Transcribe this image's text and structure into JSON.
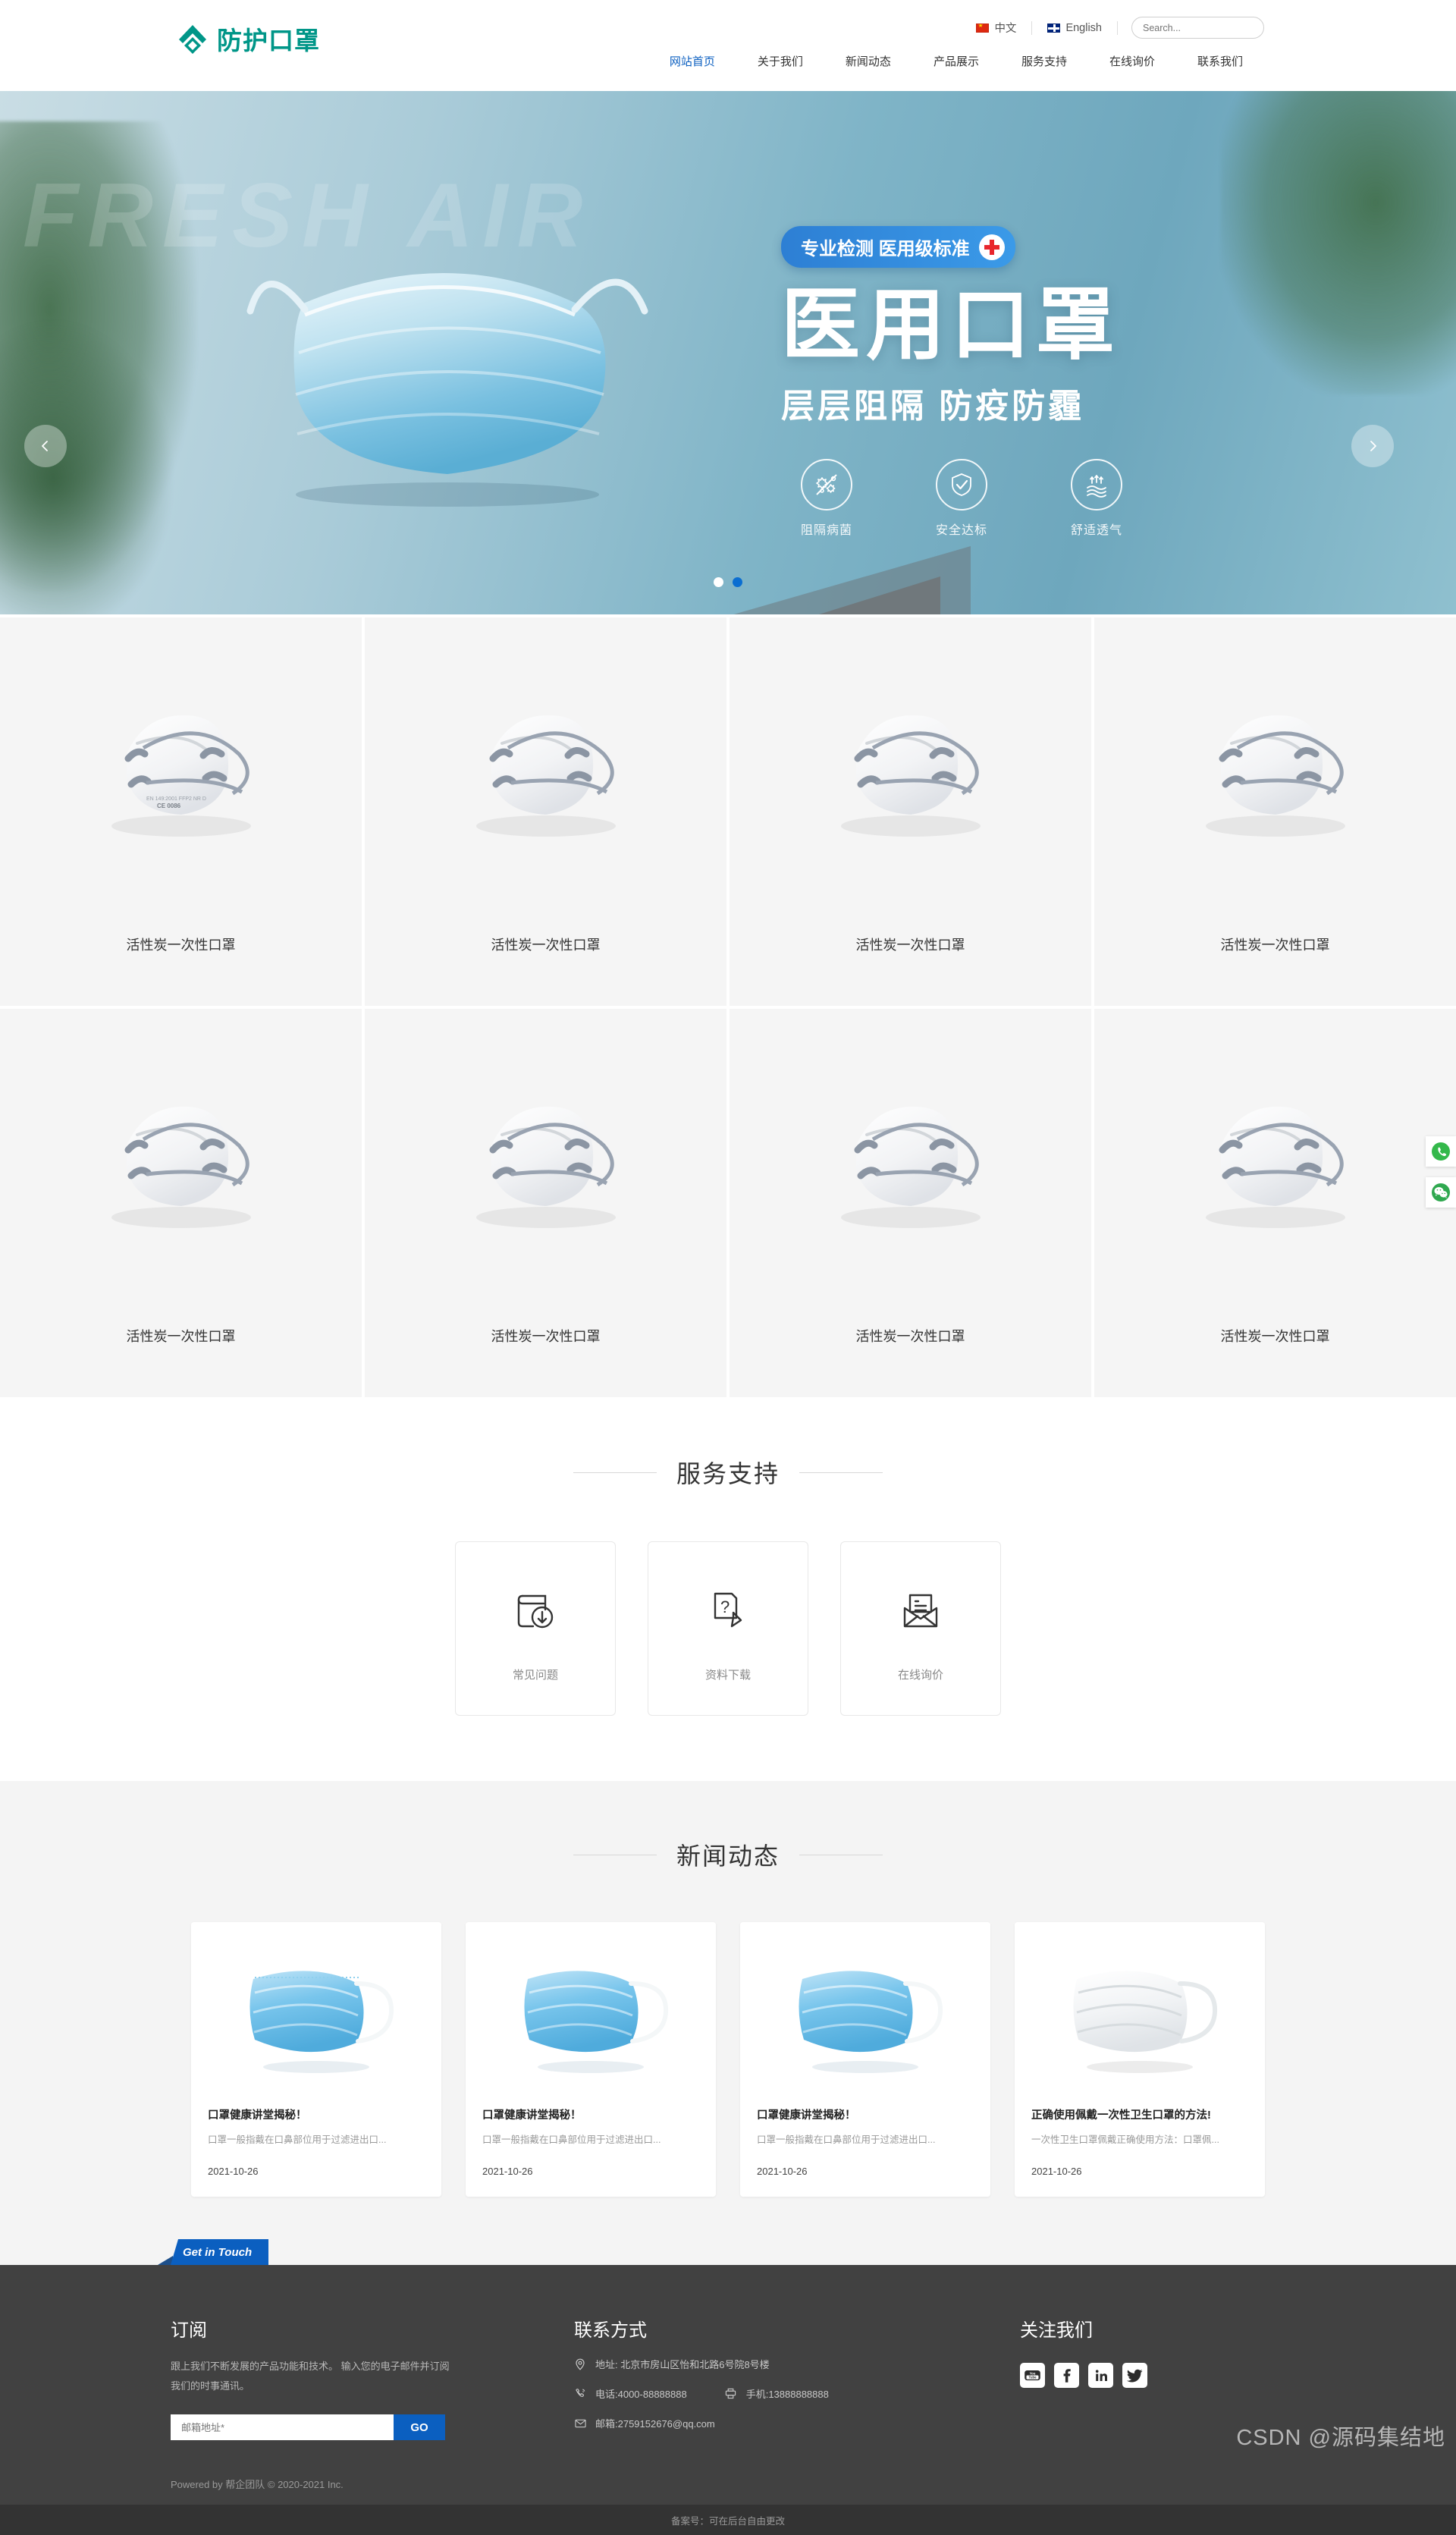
{
  "header": {
    "logo_text": "防护口罩",
    "logo_icon": "diamond-logo-icon",
    "languages": [
      {
        "label": "中文",
        "flag": "flag-cn-icon"
      },
      {
        "label": "English",
        "flag": "flag-uk-icon"
      }
    ],
    "search": {
      "placeholder": "Search...",
      "value": "",
      "button_icon": "search-icon"
    },
    "nav": [
      {
        "label": "网站首页",
        "active": true
      },
      {
        "label": "关于我们",
        "active": false
      },
      {
        "label": "新闻动态",
        "active": false
      },
      {
        "label": "产品展示",
        "active": false
      },
      {
        "label": "服务支持",
        "active": false
      },
      {
        "label": "在线询价",
        "active": false
      },
      {
        "label": "联系我们",
        "active": false
      }
    ]
  },
  "hero": {
    "ghost_text": "FRESH AIR",
    "badge": "专业检测 医用级标准",
    "badge_icon": "medical-cross-icon",
    "title": "医用口罩",
    "subtitle": "层层阻隔 防疫防霾",
    "features": [
      {
        "label": "阻隔病菌",
        "icon": "germ-block-icon"
      },
      {
        "label": "安全达标",
        "icon": "shield-check-icon"
      },
      {
        "label": "舒适透气",
        "icon": "breathable-icon"
      }
    ],
    "prev_icon": "chevron-left-icon",
    "next_icon": "chevron-right-icon",
    "dots": [
      {
        "active": false
      },
      {
        "active": true
      }
    ]
  },
  "products": [
    {
      "name": "活性炭一次性口罩"
    },
    {
      "name": "活性炭一次性口罩"
    },
    {
      "name": "活性炭一次性口罩"
    },
    {
      "name": "活性炭一次性口罩"
    },
    {
      "name": "活性炭一次性口罩"
    },
    {
      "name": "活性炭一次性口罩"
    },
    {
      "name": "活性炭一次性口罩"
    },
    {
      "name": "活性炭一次性口罩"
    }
  ],
  "service": {
    "title": "服务支持",
    "cards": [
      {
        "label": "常见问题",
        "icon": "book-download-icon"
      },
      {
        "label": "资料下载",
        "icon": "document-pencil-icon"
      },
      {
        "label": "在线询价",
        "icon": "open-envelope-icon"
      }
    ]
  },
  "news": {
    "title": "新闻动态",
    "items": [
      {
        "title": "口罩健康讲堂揭秘！",
        "desc": "口罩一般指戴在口鼻部位用于过滤进出口...",
        "date": "2021-10-26",
        "image": "blue-surgical-mask-image"
      },
      {
        "title": "口罩健康讲堂揭秘！",
        "desc": "口罩一般指戴在口鼻部位用于过滤进出口...",
        "date": "2021-10-26",
        "image": "blue-surgical-mask-image"
      },
      {
        "title": "口罩健康讲堂揭秘！",
        "desc": "口罩一般指戴在口鼻部位用于过滤进出口...",
        "date": "2021-10-26",
        "image": "blue-surgical-mask-image"
      },
      {
        "title": "正确使用佩戴一次性卫生口罩的方法!",
        "desc": "一次性卫生口罩佩戴正确使用方法：口罩佩...",
        "date": "2021-10-26",
        "image": "white-surgical-mask-image"
      }
    ]
  },
  "footer": {
    "get_in_touch": "Get in Touch",
    "subscribe": {
      "heading": "订阅",
      "text": "跟上我们不断发展的产品功能和技术。 输入您的电子邮件并订阅我们的时事通讯。",
      "placeholder": "邮箱地址*",
      "value": "",
      "button": "GO"
    },
    "contact": {
      "heading": "联系方式",
      "address": "地址: 北京市房山区怡和北路6号院8号楼",
      "address_icon": "location-pin-icon",
      "phone": "电话:4000-88888888",
      "phone_icon": "phone-icon",
      "mobile": "手机:13888888888",
      "mobile_icon": "fax-icon",
      "email": "邮箱:2759152676@qq.com",
      "email_icon": "envelope-icon"
    },
    "follow": {
      "heading": "关注我们",
      "socials": [
        {
          "name": "youtube-icon",
          "label": "YouTube"
        },
        {
          "name": "facebook-icon",
          "label": "Facebook"
        },
        {
          "name": "linkedin-icon",
          "label": "LinkedIn"
        },
        {
          "name": "twitter-icon",
          "label": "Twitter"
        }
      ]
    },
    "powered": "Powered by 帮企团队 © 2020-2021 Inc.",
    "icp": "备案号：可在后台自由更改"
  },
  "side_float": [
    {
      "name": "whatsapp-icon"
    },
    {
      "name": "wechat-icon"
    }
  ],
  "watermark": "CSDN @源码集结地",
  "colors": {
    "brand_teal": "#009688",
    "accent_blue": "#0b5fc0",
    "footer_dark": "#414141",
    "bottom_bar": "#333333"
  }
}
